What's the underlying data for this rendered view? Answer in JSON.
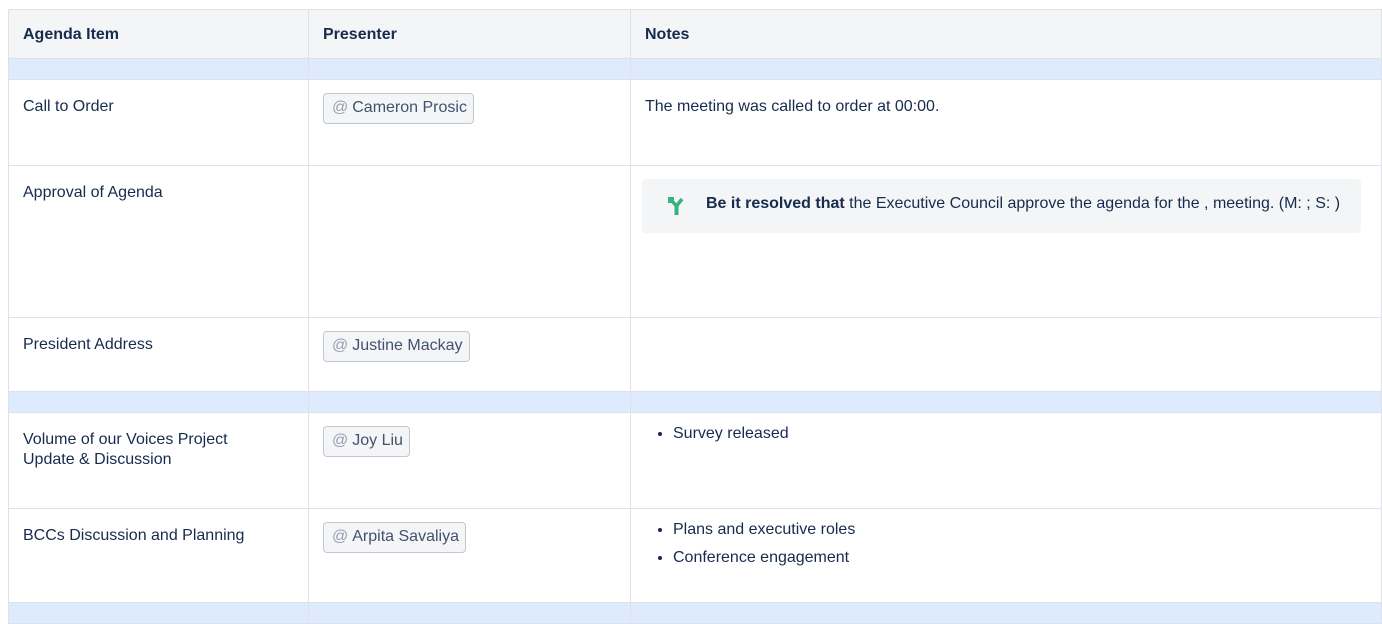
{
  "table": {
    "headers": [
      "Agenda Item",
      "Presenter",
      "Notes"
    ],
    "rows": [
      {
        "item": "Call to Order",
        "presenter": "Cameron Prosic",
        "note": "The meeting was called to order at 00:00."
      },
      {
        "item": "Approval of Agenda",
        "presenter": "",
        "resolution_bold": "Be it resolved that",
        "resolution_text": " the Executive Council approve the agenda for the , meeting. (M: ; S: )"
      },
      {
        "item": "President Address",
        "presenter": "Justine Mackay"
      },
      {
        "item": "Volume of our Voices Project Update & Discussion",
        "presenter": "Joy Liu",
        "bullets": [
          "Survey released"
        ]
      },
      {
        "item": "BCCs Discussion and Planning",
        "presenter": "Arpita Savaliya",
        "bullets": [
          "Plans and executive roles",
          "Conference engagement"
        ]
      }
    ]
  },
  "mention_prefix": "@",
  "colors": {
    "separator": "#deebff",
    "header_bg": "#f4f5f7",
    "border": "#dfe1e6",
    "resolution_icon": "#36b37e"
  },
  "icons": {
    "resolution": "decision-branch-icon"
  }
}
